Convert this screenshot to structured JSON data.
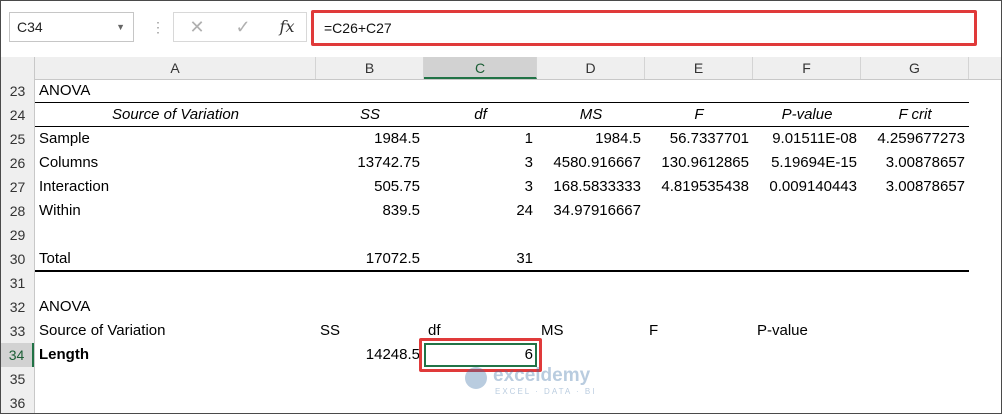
{
  "formula_bar": {
    "name_box": "C34",
    "formula": "=C26+C27",
    "separator": "⋮",
    "cancel": "✕",
    "enter": "✓",
    "fx": "fx"
  },
  "columns": [
    "A",
    "B",
    "C",
    "D",
    "E",
    "F",
    "G"
  ],
  "selected_column": "C",
  "rows": [
    "23",
    "24",
    "25",
    "26",
    "27",
    "28",
    "29",
    "30",
    "31",
    "32",
    "33",
    "34",
    "35",
    "36"
  ],
  "selected_row": "34",
  "table1": {
    "title": "ANOVA",
    "headers": [
      "Source of Variation",
      "SS",
      "df",
      "MS",
      "F",
      "P-value",
      "F crit"
    ],
    "rows": [
      [
        "Sample",
        "1984.5",
        "1",
        "1984.5",
        "56.7337701",
        "9.01511E-08",
        "4.259677273"
      ],
      [
        "Columns",
        "13742.75",
        "3",
        "4580.916667",
        "130.9612865",
        "5.19694E-15",
        "3.00878657"
      ],
      [
        "Interaction",
        "505.75",
        "3",
        "168.5833333",
        "4.819535438",
        "0.009140443",
        "3.00878657"
      ],
      [
        "Within",
        "839.5",
        "24",
        "34.97916667",
        "",
        "",
        ""
      ],
      [
        "",
        "",
        "",
        "",
        "",
        "",
        ""
      ],
      [
        "Total",
        "17072.5",
        "31",
        "",
        "",
        "",
        ""
      ]
    ]
  },
  "table2": {
    "title": "ANOVA",
    "headers": [
      "Source of Variation",
      "SS",
      "df",
      "MS",
      "F",
      "P-value"
    ],
    "row_label": "Length",
    "ss": "14248.5",
    "df": "6"
  },
  "watermark": {
    "name": "exceldemy",
    "tag": "EXCEL · DATA · BI"
  },
  "colors": {
    "highlight": "#e03a3a",
    "selection": "#217346"
  }
}
